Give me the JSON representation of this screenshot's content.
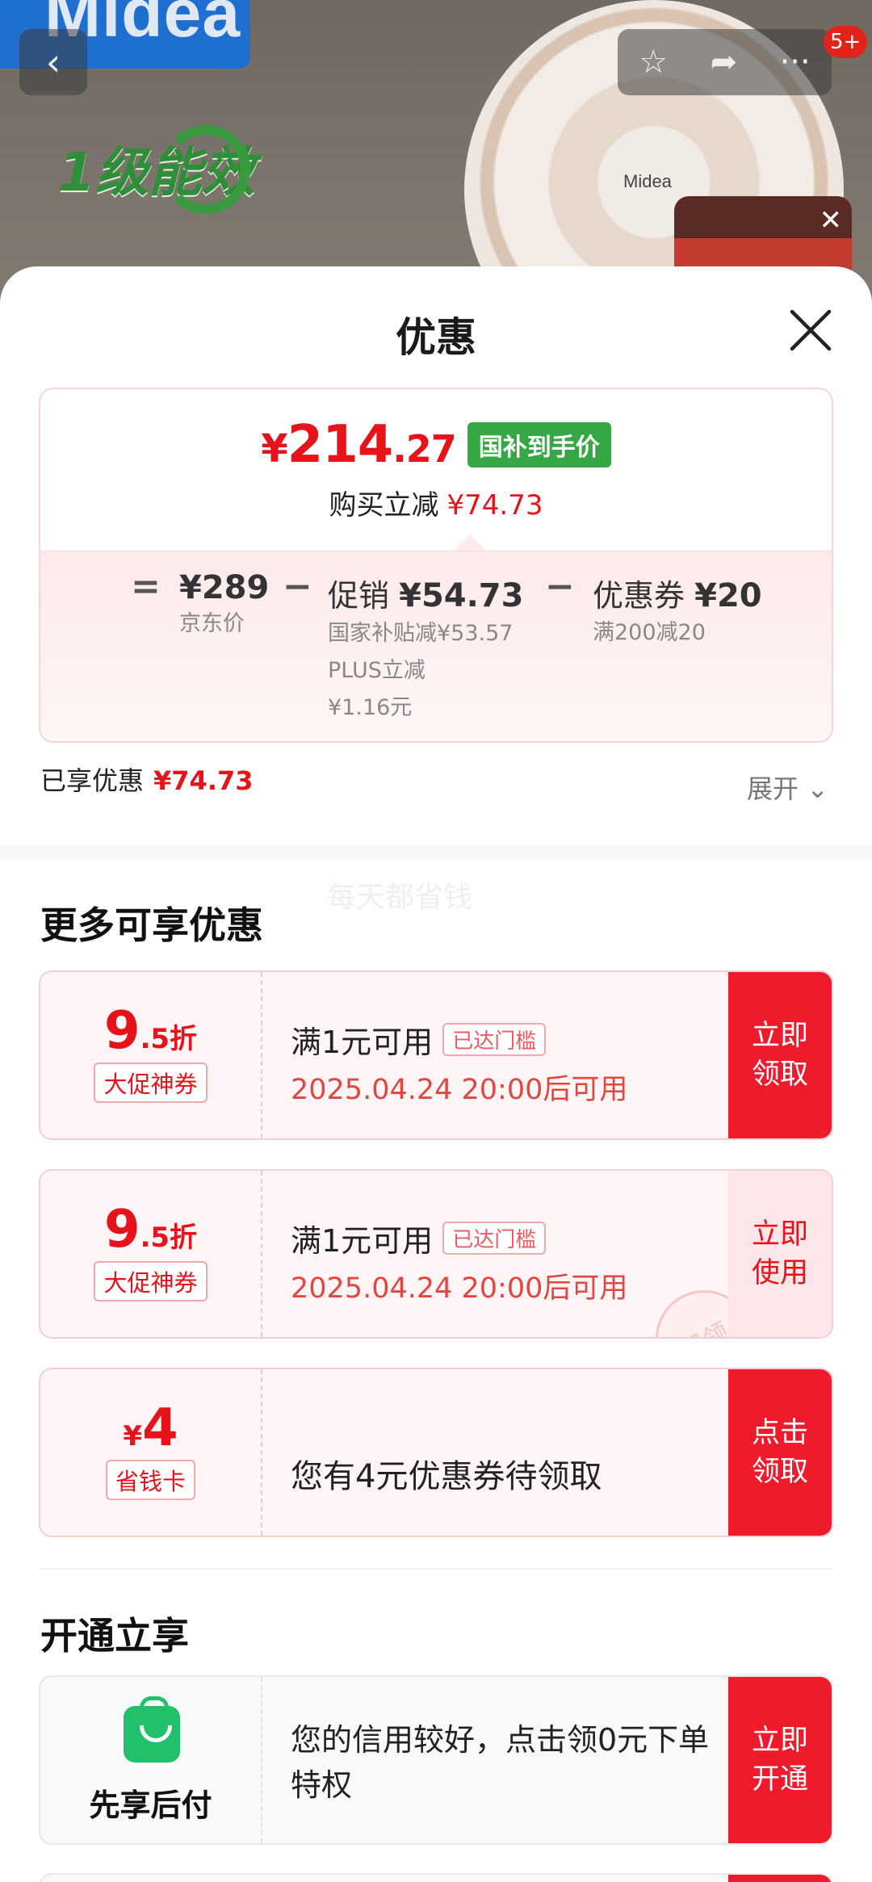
{
  "background": {
    "brand": "Midea",
    "energy_label": "1级能效",
    "fan_logo": "Midea",
    "notification_count": "5+"
  },
  "header": {
    "title": "优惠"
  },
  "price_summary": {
    "currency": "¥",
    "final_int": "214",
    "final_dec": ".27",
    "final_tag": "国补到手价",
    "reduce_label": "购买立减",
    "reduce_value": "¥74.73",
    "jd_price": "¥289",
    "jd_price_label": "京东价",
    "promo_label": "促销",
    "promo_value": "¥54.73",
    "promo_detail_1": "国家补贴减¥53.57",
    "promo_detail_2": "PLUS立减",
    "promo_detail_3": "¥1.16元",
    "coupon_label": "优惠券",
    "coupon_value": "¥20",
    "coupon_detail": "满200减20",
    "op_equal": "=",
    "op_minus": "−"
  },
  "enjoyed": {
    "label": "已享优惠",
    "value": "¥74.73",
    "expand": "展开"
  },
  "watermark": "每天都省钱",
  "more_section": {
    "title": "更多可享优惠",
    "coupons": [
      {
        "num": "9",
        "suffix": ".5折",
        "tag": "大促神券",
        "cond": "满1元可用",
        "reach": "已达门槛",
        "time": "2025.04.24 20:00后可用",
        "action_1": "立即",
        "action_2": "领取"
      },
      {
        "num": "9",
        "suffix": ".5折",
        "tag": "大促神券",
        "cond": "满1元可用",
        "reach": "已达门槛",
        "time": "2025.04.24 20:00后可用",
        "action_1": "立即",
        "action_2": "使用",
        "stamp": "已领"
      },
      {
        "cur": "¥",
        "num": "4",
        "tag": "省钱卡",
        "text": "您有4元优惠券待领取",
        "action_1": "点击",
        "action_2": "领取"
      }
    ]
  },
  "open_section": {
    "title": "开通立享",
    "pay": {
      "name": "先享后付",
      "text": "您的信用较好，点击领0元下单特权",
      "action_1": "立即",
      "action_2": "开通"
    }
  },
  "colors": {
    "accent_red": "#e7131a",
    "button_red": "#ef1a2b",
    "tag_green": "#35a845"
  }
}
